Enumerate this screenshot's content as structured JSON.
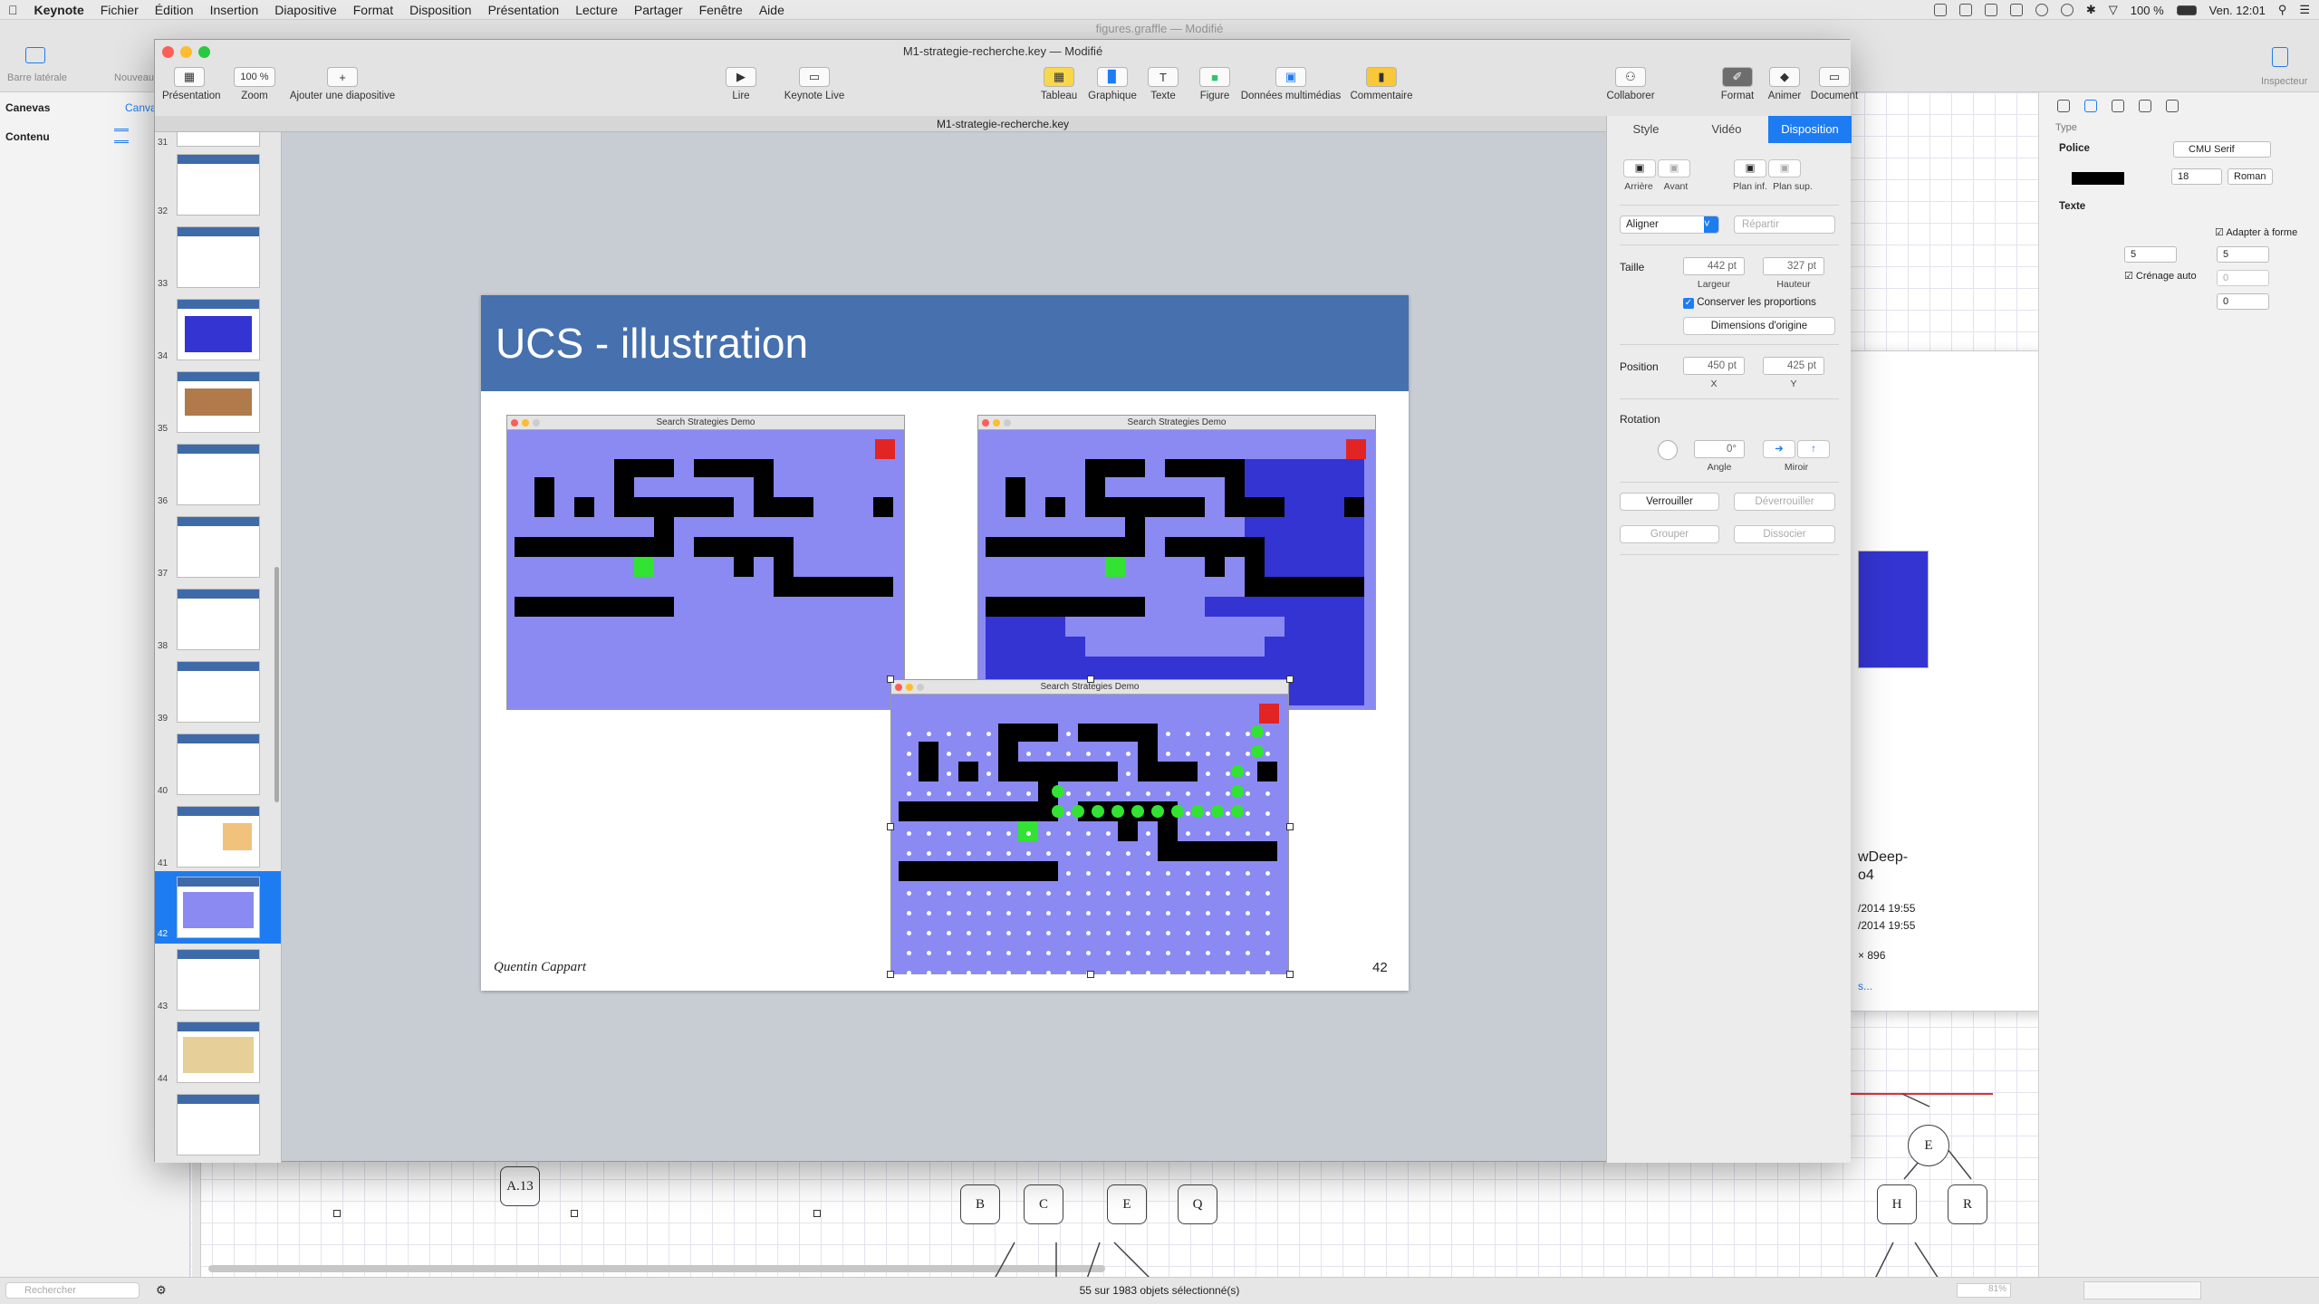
{
  "menubar": {
    "app": "Keynote",
    "items": [
      "Fichier",
      "Édition",
      "Insertion",
      "Diapositive",
      "Format",
      "Disposition",
      "Présentation",
      "Lecture",
      "Partager",
      "Fenêtre",
      "Aide"
    ],
    "battery": "100 %",
    "clock": "Ven. 12:01"
  },
  "graffle": {
    "title": "figures.graffle — Modifié",
    "sidebar_label": "Barre latérale",
    "new_label": "Nouveau",
    "canvas_label": "Canevas",
    "canvas_tab": "Canva",
    "contenu_label": "Contenu",
    "inspector_label": "Inspecteur",
    "type_label": "Type",
    "police_label": "Police",
    "font_name": "CMU Serif",
    "font_size": "18",
    "font_style": "Roman",
    "texte_label": "Texte",
    "adapter_label": "Adapter à forme",
    "crenage_label": "Crénage auto",
    "field_a": "5",
    "field_b": "5",
    "field_c": "0",
    "field_d": "0",
    "search_placeholder": "Rechercher",
    "status": "55 sur 1983 objets sélectionné(s)",
    "zoom": "81%",
    "file_name_1": "wDeep-",
    "file_name_2": "o4",
    "file_date_1": "/2014 19:55",
    "file_date_2": "/2014 19:55",
    "file_dims": "× 896",
    "file_more": "s...",
    "nodes": [
      "A.13",
      "B",
      "C",
      "E",
      "Q",
      "E",
      "H",
      "R"
    ]
  },
  "keynote": {
    "window_title": "M1-strategie-recherche.key — Modifié",
    "doc_title": "M1-strategie-recherche.key",
    "toolbar": {
      "presentation": "Présentation",
      "zoom_value": "100 %",
      "zoom": "Zoom",
      "add_slide": "Ajouter une diapositive",
      "play": "Lire",
      "keynote_live": "Keynote Live",
      "table": "Tableau",
      "chart": "Graphique",
      "text": "Texte",
      "shape": "Figure",
      "media": "Données multimédias",
      "comment": "Commentaire",
      "collaborate": "Collaborer",
      "format": "Format",
      "animate": "Animer",
      "document": "Document"
    },
    "slide_numbers": [
      "31",
      "32",
      "33",
      "34",
      "35",
      "36",
      "37",
      "38",
      "39",
      "40",
      "41",
      "42",
      "43",
      "44"
    ],
    "selected_slide": "42",
    "slide": {
      "title": "UCS - illustration",
      "author": "Quentin Cappart",
      "number": "42",
      "demo_title": "Search Strategies Demo"
    },
    "inspector": {
      "tabs": [
        "Style",
        "Vidéo",
        "Disposition"
      ],
      "active_tab": "Disposition",
      "back": "Arrière",
      "front": "Avant",
      "backward": "Plan inf.",
      "forward": "Plan sup.",
      "align": "Aligner",
      "distribute": "Répartir",
      "size_label": "Taille",
      "width": "442 pt",
      "width_label": "Largeur",
      "height": "327 pt",
      "height_label": "Hauteur",
      "keep_proportions": "Conserver les proportions",
      "original_size": "Dimensions d'origine",
      "position_label": "Position",
      "x": "450 pt",
      "x_label": "X",
      "y": "425 pt",
      "y_label": "Y",
      "rotation_label": "Rotation",
      "angle": "0°",
      "angle_label": "Angle",
      "mirror_label": "Miroir",
      "lock": "Verrouiller",
      "unlock": "Déverrouiller",
      "group": "Grouper",
      "ungroup": "Dissocier"
    }
  },
  "colors": {
    "slide_header": "#4670ae",
    "maze_background": "#8a8af2",
    "visited": "#3434d2",
    "goal": "#e32424",
    "agent": "#33e333",
    "accent": "#1d7cf2"
  }
}
